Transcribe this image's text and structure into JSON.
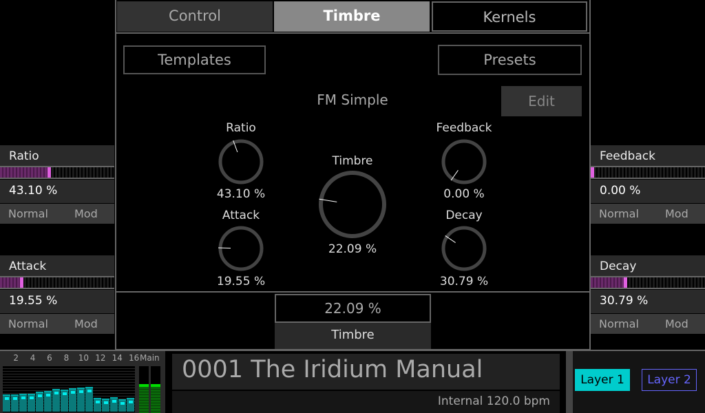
{
  "tabs": [
    {
      "label": "Control",
      "active": false
    },
    {
      "label": "Timbre",
      "active": true
    },
    {
      "label": "Kernels",
      "active": false
    }
  ],
  "templates_label": "Templates",
  "presets_label": "Presets",
  "kernel_name": "FM Simple",
  "edit_label": "Edit",
  "knobs": {
    "ratio": {
      "label": "Ratio",
      "value": "43.10 %",
      "level": 0.431
    },
    "feedback": {
      "label": "Feedback",
      "value": "0.00 %",
      "level": 0.0
    },
    "timbre": {
      "label": "Timbre",
      "value": "22.09 %",
      "level": 0.2209
    },
    "attack": {
      "label": "Attack",
      "value": "19.55 %",
      "level": 0.1955
    },
    "decay": {
      "label": "Decay",
      "value": "30.79 %",
      "level": 0.3079
    }
  },
  "selected": {
    "value": "22.09 %",
    "label": "Timbre"
  },
  "side_params": {
    "left": [
      {
        "label": "Ratio",
        "value": "43.10 %",
        "level": 0.431,
        "normal": "Normal",
        "mod": "Mod"
      },
      {
        "label": "Attack",
        "value": "19.55 %",
        "level": 0.1955,
        "normal": "Normal",
        "mod": "Mod"
      }
    ],
    "right": [
      {
        "label": "Feedback",
        "value": "0.00 %",
        "level": 0.0,
        "normal": "Normal",
        "mod": "Mod"
      },
      {
        "label": "Decay",
        "value": "30.79 %",
        "level": 0.3079,
        "normal": "Normal",
        "mod": "Mod"
      }
    ]
  },
  "mixer": {
    "channel_labels": [
      "2",
      "4",
      "6",
      "8",
      "10",
      "12",
      "14",
      "16"
    ],
    "main_label": "Main",
    "levels": [
      0.38,
      0.38,
      0.39,
      0.39,
      0.44,
      0.45,
      0.5,
      0.48,
      0.52,
      0.53,
      0.55,
      0.3,
      0.29,
      0.32,
      0.27,
      0.3
    ],
    "main_levels": [
      0.63,
      0.63
    ],
    "channel_color": "#0a7a7a",
    "main_color": "#0a6a0a"
  },
  "preset_title": "0001 The Iridium Manual",
  "tempo": "Internal 120.0 bpm",
  "layers": [
    {
      "label": "Layer 1",
      "active": true,
      "color": "#00cccc"
    },
    {
      "label": "Layer 2",
      "active": false,
      "color": "#6666ff"
    }
  ]
}
